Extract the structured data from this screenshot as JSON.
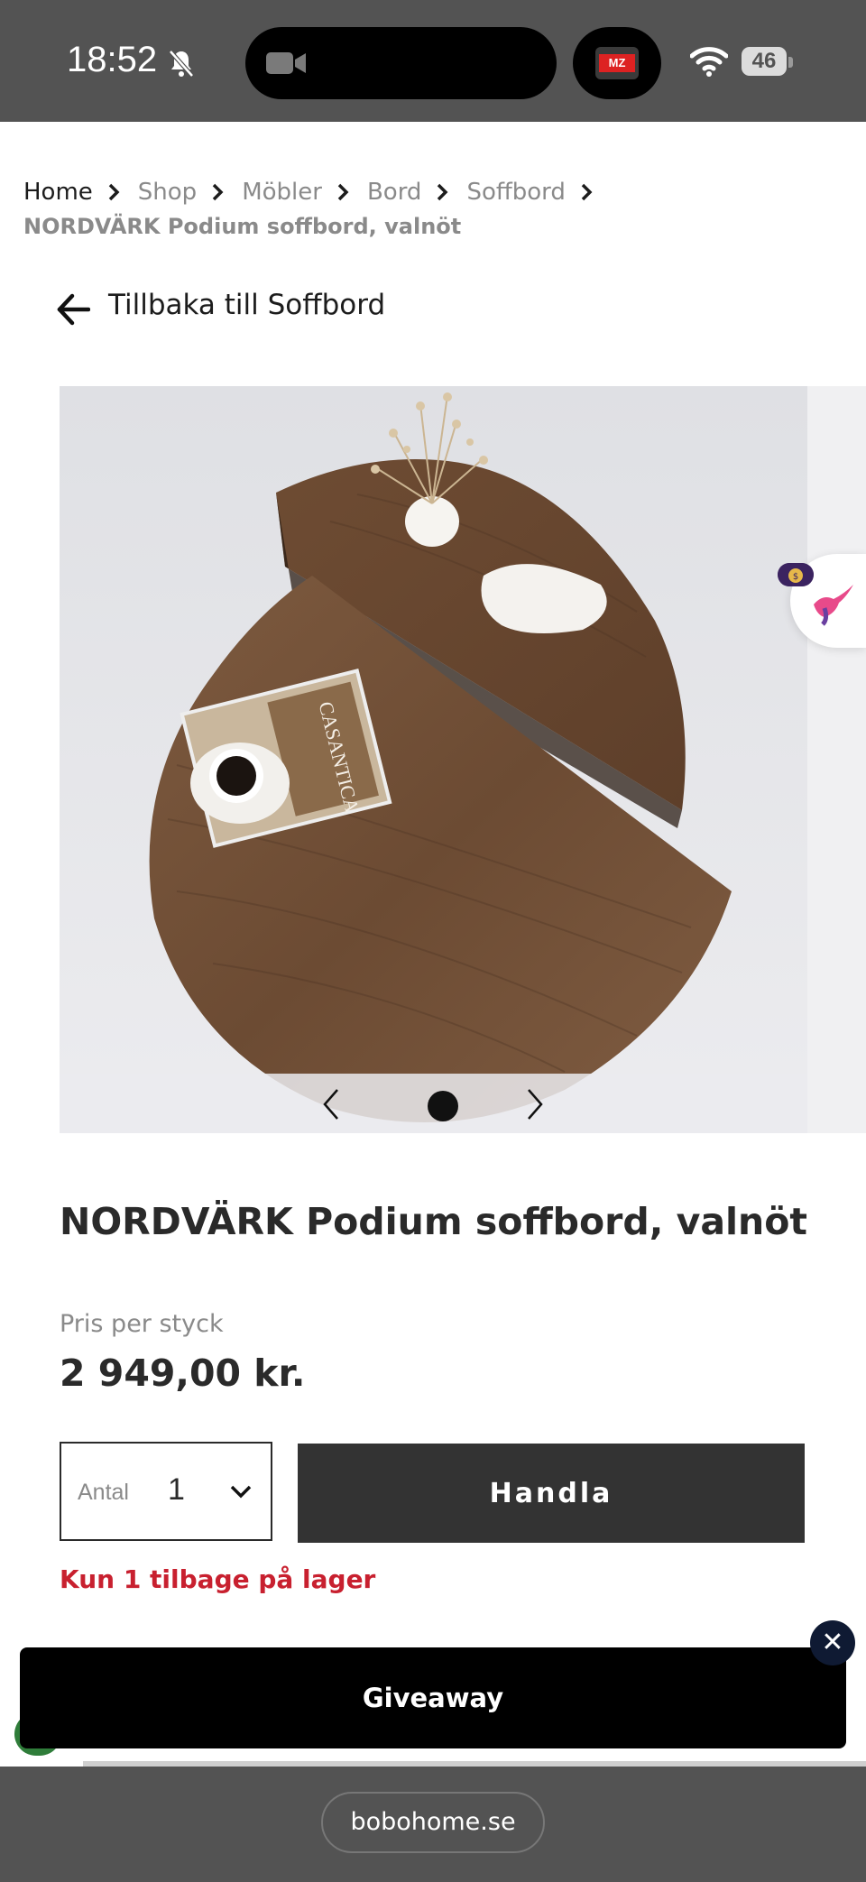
{
  "status_bar": {
    "time": "18:52",
    "battery": "46",
    "app_badge": "MZ"
  },
  "breadcrumb": {
    "items": [
      "Home",
      "Shop",
      "Möbler",
      "Bord",
      "Soffbord"
    ],
    "current": "NORDVÄRK Podium soffbord, valnöt"
  },
  "back_link": {
    "label": "Tillbaka till Soffbord"
  },
  "gallery": {
    "magazine_title": "CASANTICA",
    "current_slide": 1,
    "total_slides": 1
  },
  "product": {
    "title": "NORDVÄRK Podium soffbord, valnöt",
    "price_label": "Pris per styck",
    "price": "2 949,00 kr.",
    "quantity_label": "Antal",
    "quantity_value": "1",
    "buy_label": "Handla",
    "stock_note": "Kun 1 tilbage på lager"
  },
  "giveaway": {
    "label": "Giveaway",
    "close_symbol": "✕"
  },
  "browser": {
    "url": "bobohome.se"
  },
  "colors": {
    "status_bar_bg": "#535353",
    "buy_button_bg": "#333333",
    "stock_red": "#c8202f",
    "giveaway_bg": "#000000"
  }
}
